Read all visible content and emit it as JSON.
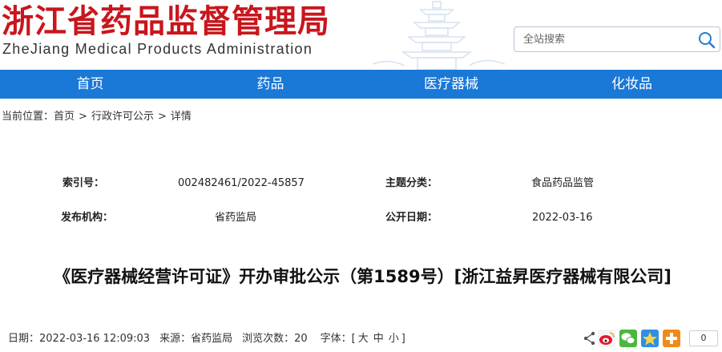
{
  "header": {
    "logo_cn": "浙江省药品监督管理局",
    "logo_en": "ZheJiang Medical Products Administration",
    "search_placeholder": "全站搜索"
  },
  "nav": {
    "items": [
      {
        "label": "首页"
      },
      {
        "label": "药品"
      },
      {
        "label": "医疗器械"
      },
      {
        "label": "化妆品"
      }
    ]
  },
  "breadcrumb": {
    "prefix": "当前位置：",
    "items": [
      "首页",
      "行政许可公示",
      "详情"
    ],
    "separator": ">"
  },
  "meta": {
    "index_label": "索引号：",
    "index_value": "002482461/2022-45857",
    "category_label": "主题分类：",
    "category_value": "食品药品监管",
    "publisher_label": "发布机构：",
    "publisher_value": "省药监局",
    "date_label": "公开日期：",
    "date_value": "2022-03-16"
  },
  "article": {
    "title": "《医疗器械经营许可证》开办审批公示（第1589号）[浙江益昇医疗器械有限公司]"
  },
  "info": {
    "date": "日期：2022-03-16 12:09:03",
    "source": "来源：省药监局",
    "views": "浏览次数：20",
    "font_prefix": "字体：[",
    "font_large": "大",
    "font_medium": "中",
    "font_small": "小",
    "font_suffix": "]"
  },
  "share": {
    "count": "0"
  },
  "colors": {
    "brand_red": "#c8161d",
    "nav_blue": "#1a78d7"
  }
}
